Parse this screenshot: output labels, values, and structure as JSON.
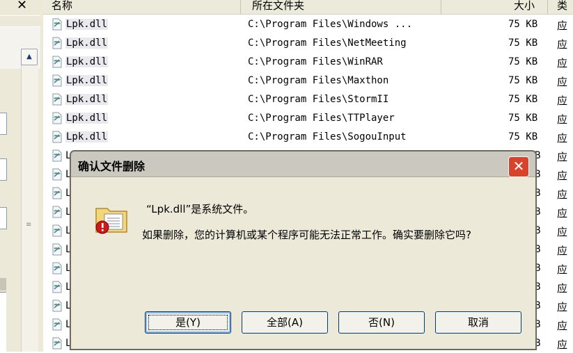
{
  "header": {
    "close_glyph": "✕",
    "col_name": "名称",
    "col_path": "所在文件夹",
    "col_size": "大小",
    "col_type": "类"
  },
  "rows": [
    {
      "name": "Lpk.dll",
      "path": "C:\\Program Files\\Windows ...",
      "size": "75 KB",
      "type": "应"
    },
    {
      "name": "Lpk.dll",
      "path": "C:\\Program Files\\NetMeeting",
      "size": "75 KB",
      "type": "应"
    },
    {
      "name": "Lpk.dll",
      "path": "C:\\Program Files\\WinRAR",
      "size": "75 KB",
      "type": "应"
    },
    {
      "name": "Lpk.dll",
      "path": "C:\\Program Files\\Maxthon",
      "size": "75 KB",
      "type": "应"
    },
    {
      "name": "Lpk.dll",
      "path": "C:\\Program Files\\StormII",
      "size": "75 KB",
      "type": "应"
    },
    {
      "name": "Lpk.dll",
      "path": "C:\\Program Files\\TTPlayer",
      "size": "75 KB",
      "type": "应"
    },
    {
      "name": "Lpk.dll",
      "path": "C:\\Program Files\\SogouInput",
      "size": "75 KB",
      "type": "应"
    }
  ],
  "hidden_rows": {
    "name_fragment": "L",
    "size_fragment": "B",
    "type": "应"
  },
  "dialog": {
    "title": "确认文件删除",
    "close_glyph": "✕",
    "message_line1": "“Lpk.dll”是系统文件。",
    "message_line2": "如果删除，您的计算机或某个程序可能无法正常工作。确实要删除它吗?",
    "buttons": {
      "yes": "是(Y)",
      "all": "全部(A)",
      "no": "否(N)",
      "cancel": "取消"
    }
  },
  "left_pane": {
    "scroll_up_glyph": "▲",
    "grip_glyph": "≡"
  },
  "colors": {
    "dialog_bg": "#ece9d8",
    "titlebar": "#cbc8c0",
    "close_red": "#d9432b",
    "button_border": "#003c74"
  }
}
